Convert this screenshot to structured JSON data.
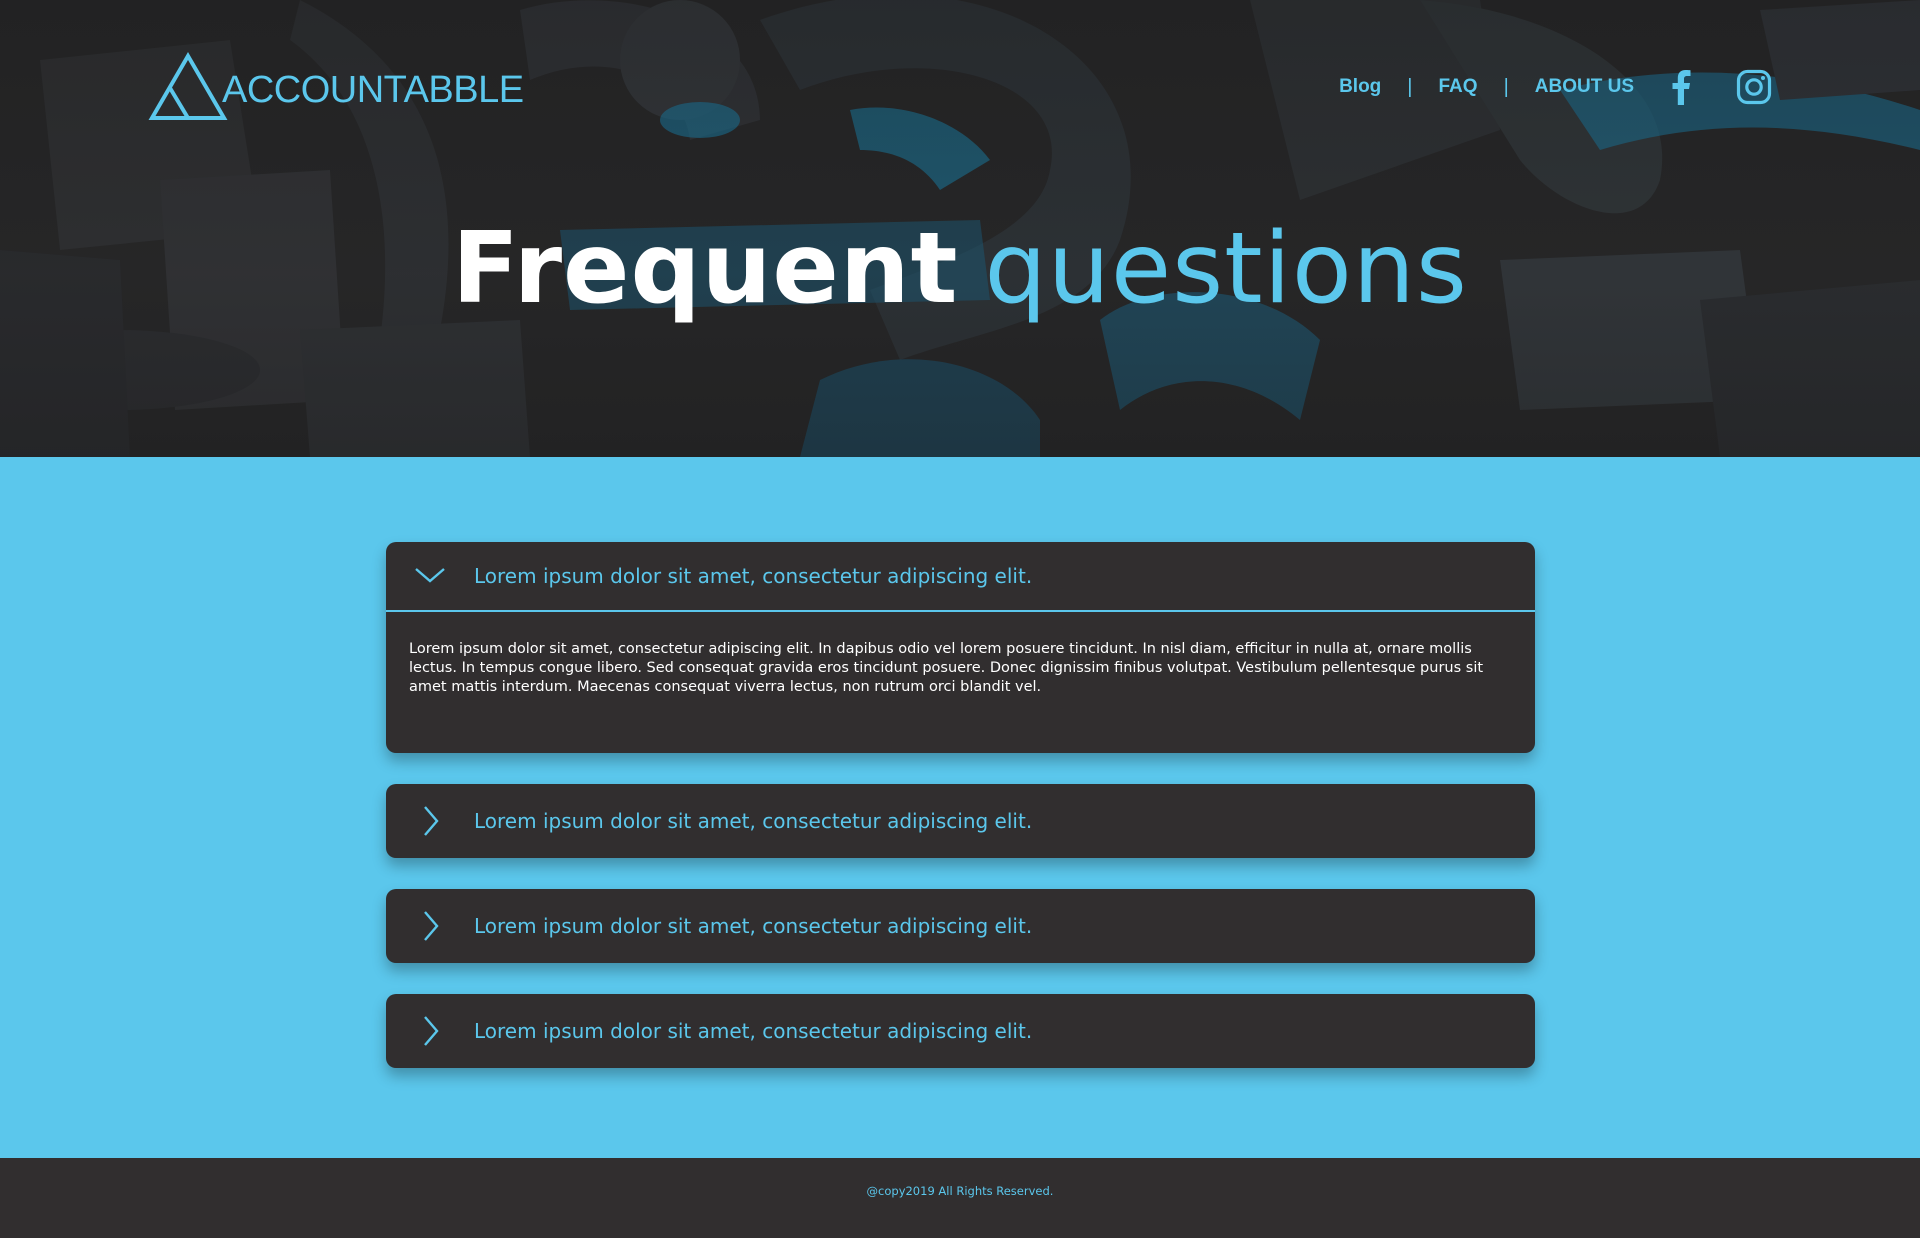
{
  "brand": {
    "name": "ACCOUNTABBLE",
    "accent": "#5bc7ec",
    "dark": "#312e2f"
  },
  "nav": {
    "links": [
      {
        "label": "Blog"
      },
      {
        "label": "FAQ"
      },
      {
        "label": "ABOUT US"
      }
    ],
    "separator": "|",
    "social": [
      {
        "icon": "facebook-icon"
      },
      {
        "icon": "instagram-icon"
      }
    ]
  },
  "hero": {
    "title_bold": "Frequent",
    "title_light": "questions"
  },
  "faq": {
    "items": [
      {
        "question": "Lorem ipsum dolor sit amet, consectetur adipiscing elit.",
        "answer": "Lorem ipsum dolor sit amet, consectetur adipiscing elit. In dapibus odio vel lorem posuere tincidunt. In nisl diam, efficitur in nulla at, ornare mollis lectus. In tempus congue libero. Sed consequat gravida eros tincidunt posuere. Donec dignissim finibus volutpat. Vestibulum pellentesque purus sit amet mattis interdum. Maecenas consequat viverra lectus, non rutrum orci blandit vel.",
        "expanded": true,
        "icon": "chevron-down-icon"
      },
      {
        "question": "Lorem ipsum dolor sit amet, consectetur adipiscing elit.",
        "expanded": false,
        "icon": "chevron-right-icon"
      },
      {
        "question": "Lorem ipsum dolor sit amet, consectetur adipiscing elit.",
        "expanded": false,
        "icon": "chevron-right-icon"
      },
      {
        "question": "Lorem ipsum dolor sit amet, consectetur adipiscing elit.",
        "expanded": false,
        "icon": "chevron-right-icon"
      }
    ]
  },
  "footer": {
    "copyright": "@copy2019 All Rights Reserved."
  }
}
